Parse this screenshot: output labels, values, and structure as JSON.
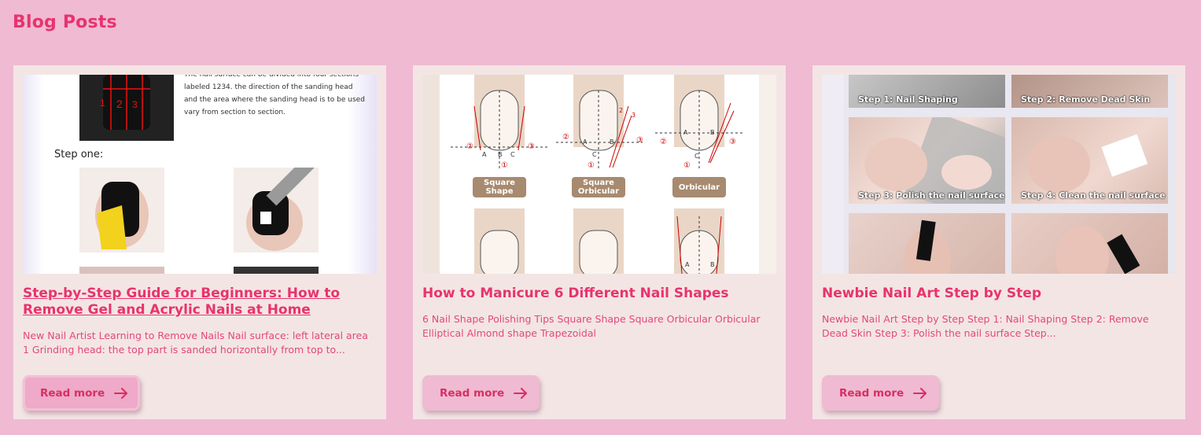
{
  "page": {
    "title": "Blog Posts"
  },
  "colors": {
    "background": "#efbad2",
    "accent": "#e8336e",
    "card": "#f4e5e5"
  },
  "posts": [
    {
      "title": "Step-by-Step Guide for Beginners: How to Remove Gel and Acrylic Nails at Home",
      "excerpt": "New Nail Artist Learning to Remove Nails Nail surface: left lateral area 1 Grinding head: the top part is sanded horizontally from top to...",
      "read_more": "Read more",
      "thumbnail": {
        "text": "The nail surface can be divided into four sections labeled 1234. the direction of the sanding head and the area where the sanding head is to be used vary from section to section.",
        "step": "Step one:",
        "numbers": [
          "1",
          "2",
          "3"
        ]
      }
    },
    {
      "title": "How to Manicure 6 Different Nail Shapes",
      "excerpt": "6 Nail Shape Polishing Tips Square Shape Square Orbicular Orbicular Elliptical Almond shape Trapezoidal",
      "read_more": "Read more",
      "thumbnail": {
        "shapes": [
          "Square Shape",
          "Square Orbicular",
          "Orbicular"
        ],
        "markers": [
          "A",
          "B",
          "C",
          "①",
          "②",
          "③"
        ]
      }
    },
    {
      "title": "Newbie Nail Art Step by Step",
      "excerpt": "Newbie Nail Art Step by Step Step 1: Nail Shaping Step 2: Remove Dead Skin Step 3: Polish the nail surface Step...",
      "read_more": "Read more",
      "thumbnail": {
        "steps": [
          "Step 1: Nail Shaping",
          "Step 2: Remove Dead Skin",
          "Step 3: Polish the nail surface",
          "Step 4: Clean the nail surface"
        ]
      }
    }
  ]
}
